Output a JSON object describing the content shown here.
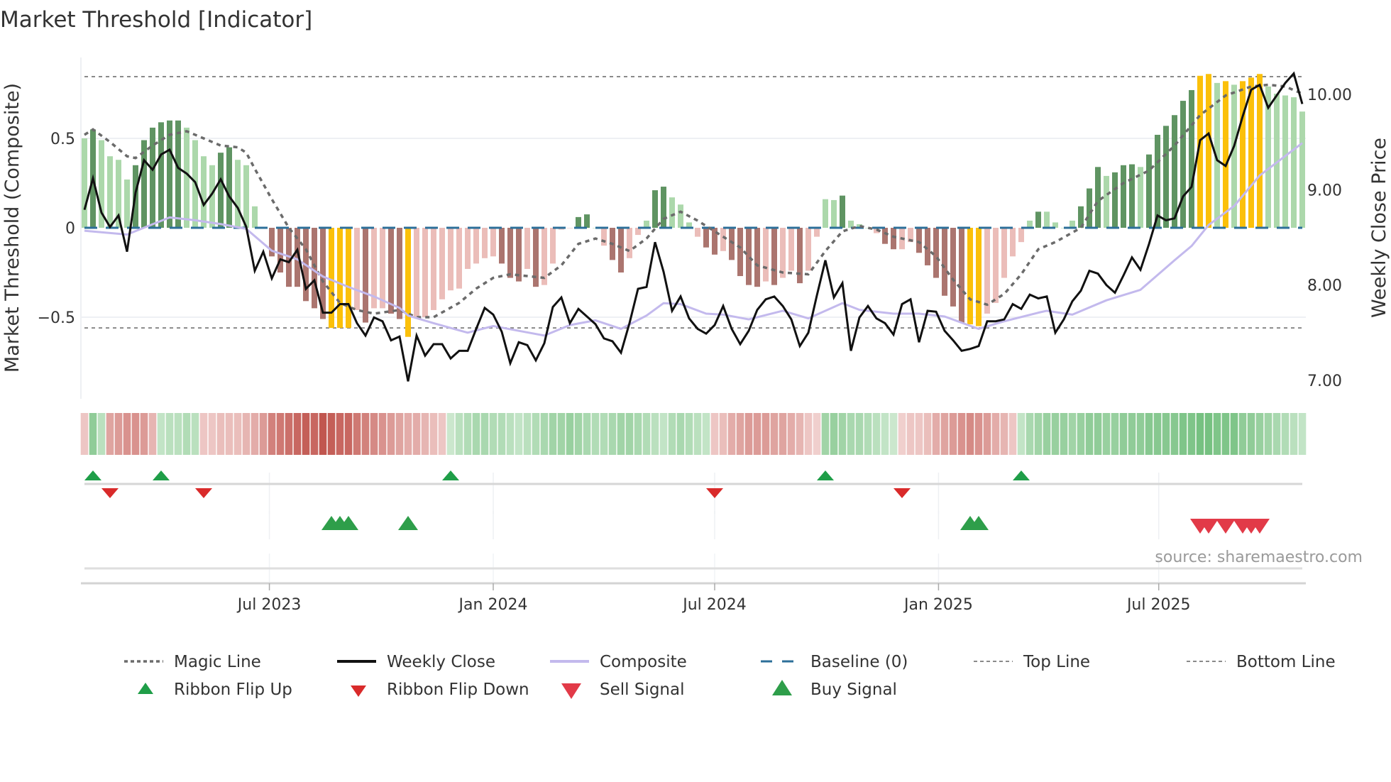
{
  "title": "Market Threshold [Indicator]",
  "source": "source: sharemaestro.com",
  "colors": {
    "strong_up": "#5f9462",
    "weak_up": "#acd8ab",
    "strong_down": "#ab756f",
    "weak_down": "#ebbdb9",
    "extreme": "#fbc00a",
    "close": "#111111",
    "composite": "#c3b9ed",
    "magic": "#6b6b6b",
    "baseline": "#2c6f99",
    "threshold": "#8a8a8a",
    "flip_up": "#1f9e48",
    "flip_down": "#d92a2a",
    "buy": "#2e9e4a",
    "sell": "#e23a48"
  },
  "legend": [
    {
      "label": "Magic Line",
      "icon": "dotted-line"
    },
    {
      "label": "Weekly Close",
      "icon": "solid-line"
    },
    {
      "label": "Composite",
      "icon": "lavender-line"
    },
    {
      "label": "Baseline (0)",
      "icon": "dashed-line"
    },
    {
      "label": "Top Line",
      "icon": "dotted-line"
    },
    {
      "label": "Bottom Line",
      "icon": "dotted-line"
    },
    {
      "label": "Ribbon Flip Up",
      "icon": "triangle-up"
    },
    {
      "label": "Ribbon Flip Down",
      "icon": "triangle-down"
    },
    {
      "label": "Sell Signal",
      "icon": "triangle-down"
    },
    {
      "label": "Buy Signal",
      "icon": "triangle-up"
    }
  ],
  "chart_data": {
    "type": "bar+line",
    "title": "Market Threshold [Indicator]",
    "ylabel": "Market Threshold (Composite)",
    "y2label": "Weekly Close Price",
    "frequency": "weekly",
    "start_date": "2023-01-30",
    "ylim": [
      -0.95,
      1.0
    ],
    "y2lim": [
      6.55,
      10.5
    ],
    "yticks": [
      {
        "value": 0.5,
        "label": "0.5"
      },
      {
        "value": 0,
        "label": "0"
      },
      {
        "value": -0.5,
        "label": "−0.5"
      }
    ],
    "y2ticks": [
      {
        "value": 10,
        "label": "10.00"
      },
      {
        "value": 9,
        "label": "9.00"
      },
      {
        "value": 8,
        "label": "8.00"
      },
      {
        "value": 7,
        "label": "7.00"
      }
    ],
    "xticks": [
      {
        "label": "Jul 2023",
        "date": "2023-07-01"
      },
      {
        "label": "Jan 2024",
        "date": "2024-01-01"
      },
      {
        "label": "Jul 2024",
        "date": "2024-07-01"
      },
      {
        "label": "Jan 2025",
        "date": "2025-01-01"
      },
      {
        "label": "Jul 2025",
        "date": "2025-07-01"
      }
    ],
    "top_line": 0.845,
    "bottom_line": -0.56,
    "baseline": 0,
    "bar_state_legend": {
      "2": "strong up",
      "1": "weak up",
      "-1": "weak down",
      "-2": "strong down",
      "3": "beyond threshold"
    },
    "composite_bars": [
      0.5,
      0.55,
      0.49,
      0.4,
      0.38,
      0.27,
      0.35,
      0.49,
      0.56,
      0.59,
      0.6,
      0.6,
      0.56,
      0.49,
      0.4,
      0.35,
      0.42,
      0.45,
      0.38,
      0.35,
      0.12,
      0.0,
      -0.16,
      -0.25,
      -0.33,
      -0.33,
      -0.41,
      -0.45,
      -0.51,
      -0.56,
      -0.56,
      -0.56,
      -0.46,
      -0.53,
      -0.45,
      -0.45,
      -0.48,
      -0.51,
      -0.61,
      -0.5,
      -0.5,
      -0.46,
      -0.4,
      -0.35,
      -0.34,
      -0.23,
      -0.2,
      -0.17,
      -0.16,
      -0.2,
      -0.28,
      -0.3,
      -0.23,
      -0.33,
      -0.32,
      -0.2,
      -0.01,
      0.0,
      0.06,
      0.075,
      0.0,
      -0.1,
      -0.18,
      -0.25,
      -0.17,
      -0.04,
      0.04,
      0.21,
      0.23,
      0.17,
      0.13,
      0.03,
      -0.05,
      -0.11,
      -0.15,
      -0.13,
      -0.18,
      -0.27,
      -0.32,
      -0.33,
      -0.3,
      -0.32,
      -0.28,
      -0.24,
      -0.31,
      -0.24,
      -0.05,
      0.16,
      0.155,
      0.18,
      0.04,
      0.02,
      0.0,
      -0.03,
      -0.09,
      -0.12,
      -0.12,
      -0.08,
      -0.14,
      -0.21,
      -0.28,
      -0.38,
      -0.44,
      -0.53,
      -0.54,
      -0.55,
      -0.48,
      -0.42,
      -0.28,
      -0.16,
      -0.08,
      0.04,
      0.09,
      0.09,
      0.03,
      0.0,
      0.04,
      0.12,
      0.22,
      0.34,
      0.29,
      0.31,
      0.35,
      0.355,
      0.34,
      0.41,
      0.52,
      0.57,
      0.63,
      0.71,
      0.77,
      0.85,
      0.86,
      0.81,
      0.82,
      0.8,
      0.82,
      0.84,
      0.86,
      0.79,
      0.75,
      0.74,
      0.73,
      0.65
    ],
    "bar_states": [
      1,
      2,
      1,
      1,
      1,
      1,
      2,
      2,
      2,
      2,
      2,
      2,
      1,
      1,
      1,
      1,
      2,
      2,
      1,
      1,
      1,
      1,
      -2,
      -2,
      -2,
      -2,
      -2,
      -2,
      -2,
      3,
      3,
      3,
      -1,
      -2,
      -1,
      -1,
      -2,
      -2,
      3,
      -1,
      -1,
      -1,
      -1,
      -1,
      -1,
      -1,
      -1,
      -1,
      -1,
      -2,
      -2,
      -2,
      -1,
      -2,
      -1,
      -1,
      -1,
      -1,
      2,
      2,
      1,
      -1,
      -2,
      -2,
      -1,
      -1,
      1,
      2,
      2,
      1,
      1,
      1,
      -1,
      -2,
      -2,
      -1,
      -2,
      -2,
      -2,
      -2,
      -1,
      -2,
      -1,
      -1,
      -2,
      -1,
      -1,
      1,
      1,
      2,
      1,
      1,
      1,
      -1,
      -2,
      -2,
      -1,
      -1,
      -2,
      -2,
      -2,
      -2,
      -2,
      -2,
      3,
      3,
      -1,
      -1,
      -1,
      -1,
      -1,
      1,
      2,
      1,
      1,
      1,
      1,
      2,
      2,
      2,
      1,
      2,
      2,
      2,
      1,
      2,
      2,
      2,
      2,
      2,
      2,
      3,
      3,
      1,
      3,
      1,
      3,
      3,
      3,
      1,
      1,
      1,
      1,
      1
    ],
    "weekly_close": [
      8.79,
      9.12,
      8.76,
      8.61,
      8.73,
      8.35,
      8.97,
      9.31,
      9.21,
      9.37,
      9.42,
      9.23,
      9.17,
      9.08,
      8.84,
      8.96,
      9.11,
      8.93,
      8.81,
      8.61,
      8.15,
      8.35,
      8.07,
      8.27,
      8.24,
      8.37,
      7.96,
      8.05,
      7.71,
      7.71,
      7.8,
      7.8,
      7.6,
      7.47,
      7.66,
      7.62,
      7.42,
      7.46,
      6.99,
      7.47,
      7.26,
      7.38,
      7.38,
      7.23,
      7.31,
      7.31,
      7.54,
      7.76,
      7.69,
      7.51,
      7.18,
      7.4,
      7.37,
      7.21,
      7.39,
      7.77,
      7.87,
      7.6,
      7.75,
      7.67,
      7.59,
      7.44,
      7.41,
      7.29,
      7.6,
      7.96,
      7.98,
      8.45,
      8.14,
      7.73,
      7.88,
      7.65,
      7.54,
      7.49,
      7.58,
      7.78,
      7.54,
      7.38,
      7.52,
      7.74,
      7.85,
      7.88,
      7.78,
      7.64,
      7.36,
      7.5,
      7.89,
      8.26,
      7.87,
      8.02,
      7.31,
      7.66,
      7.78,
      7.65,
      7.6,
      7.48,
      7.8,
      7.85,
      7.4,
      7.73,
      7.72,
      7.52,
      7.42,
      7.31,
      7.33,
      7.36,
      7.62,
      7.62,
      7.64,
      7.8,
      7.75,
      7.9,
      7.86,
      7.88,
      7.5,
      7.64,
      7.83,
      7.94,
      8.15,
      8.12,
      8.0,
      7.92,
      8.1,
      8.29,
      8.16,
      8.43,
      8.73,
      8.68,
      8.7,
      8.93,
      9.03,
      9.52,
      9.59,
      9.31,
      9.25,
      9.46,
      9.77,
      10.05,
      10.1,
      9.86,
      9.99,
      10.12,
      10.22,
      9.9
    ],
    "composite_line_price_scale": [
      [
        0,
        8.57
      ],
      [
        5,
        8.53
      ],
      [
        10,
        8.71
      ],
      [
        13,
        8.68
      ],
      [
        16,
        8.64
      ],
      [
        19,
        8.59
      ],
      [
        22,
        8.36
      ],
      [
        25,
        8.27
      ],
      [
        28,
        8.09
      ],
      [
        31,
        7.98
      ],
      [
        34,
        7.88
      ],
      [
        37,
        7.76
      ],
      [
        38,
        7.68
      ],
      [
        41,
        7.6
      ],
      [
        45,
        7.5
      ],
      [
        48,
        7.57
      ],
      [
        51,
        7.52
      ],
      [
        54,
        7.47
      ],
      [
        57,
        7.58
      ],
      [
        60,
        7.63
      ],
      [
        63,
        7.54
      ],
      [
        66,
        7.68
      ],
      [
        68,
        7.81
      ],
      [
        70,
        7.8
      ],
      [
        73,
        7.7
      ],
      [
        75,
        7.69
      ],
      [
        78,
        7.64
      ],
      [
        82,
        7.73
      ],
      [
        85,
        7.65
      ],
      [
        89,
        7.81
      ],
      [
        91,
        7.74
      ],
      [
        95,
        7.7
      ],
      [
        98,
        7.7
      ],
      [
        101,
        7.67
      ],
      [
        105,
        7.54
      ],
      [
        108,
        7.62
      ],
      [
        112,
        7.71
      ],
      [
        113,
        7.73
      ],
      [
        116,
        7.69
      ],
      [
        120,
        7.84
      ],
      [
        124,
        7.95
      ],
      [
        128,
        8.26
      ],
      [
        130,
        8.41
      ],
      [
        132,
        8.63
      ],
      [
        135,
        8.83
      ],
      [
        138,
        9.15
      ],
      [
        143,
        9.49
      ]
    ],
    "magic_line": [
      [
        0,
        0.52
      ],
      [
        1,
        0.55
      ],
      [
        3,
        0.48
      ],
      [
        5,
        0.4
      ],
      [
        6,
        0.39
      ],
      [
        8,
        0.46
      ],
      [
        10,
        0.52
      ],
      [
        12,
        0.54
      ],
      [
        14,
        0.5
      ],
      [
        16,
        0.46
      ],
      [
        18,
        0.45
      ],
      [
        19,
        0.42
      ],
      [
        20,
        0.33
      ],
      [
        22,
        0.16
      ],
      [
        24,
        0.0
      ],
      [
        26,
        -0.12
      ],
      [
        28,
        -0.3
      ],
      [
        30,
        -0.42
      ],
      [
        32,
        -0.46
      ],
      [
        34,
        -0.48
      ],
      [
        37,
        -0.46
      ],
      [
        39,
        -0.5
      ],
      [
        41,
        -0.5
      ],
      [
        44,
        -0.42
      ],
      [
        46,
        -0.34
      ],
      [
        48,
        -0.28
      ],
      [
        50,
        -0.26
      ],
      [
        52,
        -0.27
      ],
      [
        54,
        -0.28
      ],
      [
        56,
        -0.21
      ],
      [
        58,
        -0.09
      ],
      [
        60,
        -0.06
      ],
      [
        62,
        -0.09
      ],
      [
        64,
        -0.13
      ],
      [
        66,
        -0.06
      ],
      [
        68,
        0.05
      ],
      [
        70,
        0.09
      ],
      [
        72,
        0.04
      ],
      [
        75,
        -0.05
      ],
      [
        77,
        -0.11
      ],
      [
        79,
        -0.21
      ],
      [
        82,
        -0.25
      ],
      [
        85,
        -0.26
      ],
      [
        87,
        -0.13
      ],
      [
        89,
        -0.02
      ],
      [
        91,
        0.01
      ],
      [
        93,
        -0.01
      ],
      [
        95,
        -0.05
      ],
      [
        98,
        -0.08
      ],
      [
        100,
        -0.16
      ],
      [
        102,
        -0.29
      ],
      [
        104,
        -0.4
      ],
      [
        106,
        -0.43
      ],
      [
        108,
        -0.37
      ],
      [
        110,
        -0.26
      ],
      [
        112,
        -0.12
      ],
      [
        114,
        -0.08
      ],
      [
        117,
        0.0
      ],
      [
        119,
        0.15
      ],
      [
        122,
        0.25
      ],
      [
        125,
        0.32
      ],
      [
        128,
        0.46
      ],
      [
        131,
        0.63
      ],
      [
        134,
        0.74
      ],
      [
        137,
        0.79
      ],
      [
        139,
        0.8
      ],
      [
        141,
        0.79
      ],
      [
        143,
        0.75
      ]
    ],
    "ribbon_scores": [
      -0.15,
      0.5,
      0.25,
      -0.35,
      -0.4,
      -0.45,
      -0.45,
      -0.4,
      -0.25,
      0.2,
      0.25,
      0.25,
      0.3,
      0.25,
      -0.15,
      -0.15,
      -0.2,
      -0.2,
      -0.2,
      -0.25,
      -0.3,
      -0.4,
      -0.55,
      -0.6,
      -0.65,
      -0.7,
      -0.75,
      -0.7,
      -0.8,
      -0.75,
      -0.7,
      -0.7,
      -0.6,
      -0.55,
      -0.5,
      -0.45,
      -0.4,
      -0.35,
      -0.3,
      -0.3,
      -0.25,
      -0.2,
      -0.15,
      0.15,
      0.25,
      0.3,
      0.35,
      0.35,
      0.3,
      0.3,
      0.25,
      0.2,
      0.25,
      0.3,
      0.35,
      0.4,
      0.4,
      0.45,
      0.4,
      0.35,
      0.3,
      0.3,
      0.35,
      0.4,
      0.4,
      0.35,
      0.3,
      0.25,
      0.2,
      0.3,
      0.35,
      0.3,
      0.25,
      0.2,
      -0.15,
      -0.2,
      -0.3,
      -0.35,
      -0.4,
      -0.4,
      -0.4,
      -0.35,
      -0.35,
      -0.3,
      -0.25,
      -0.15,
      -0.1,
      0.4,
      0.45,
      0.4,
      0.35,
      0.35,
      0.3,
      0.25,
      0.2,
      0.15,
      -0.1,
      -0.15,
      -0.15,
      -0.2,
      -0.3,
      -0.35,
      -0.4,
      -0.45,
      -0.5,
      -0.45,
      -0.4,
      -0.3,
      -0.25,
      -0.15,
      0.2,
      0.35,
      0.4,
      0.45,
      0.45,
      0.45,
      0.4,
      0.45,
      0.5,
      0.5,
      0.45,
      0.45,
      0.5,
      0.5,
      0.5,
      0.55,
      0.55,
      0.55,
      0.55,
      0.6,
      0.6,
      0.65,
      0.65,
      0.6,
      0.6,
      0.6,
      0.5,
      0.5,
      0.45,
      0.4,
      0.35,
      0.3,
      0.25,
      0.2
    ],
    "ribbon_flip_up_weeks": [
      1,
      9,
      43,
      87,
      110
    ],
    "ribbon_flip_down_weeks": [
      3,
      14,
      74,
      96
    ],
    "buy_signal_weeks": [
      29,
      30,
      31,
      38,
      104,
      105
    ],
    "sell_signal_weeks": [
      131,
      132,
      134,
      136,
      137,
      138
    ]
  }
}
